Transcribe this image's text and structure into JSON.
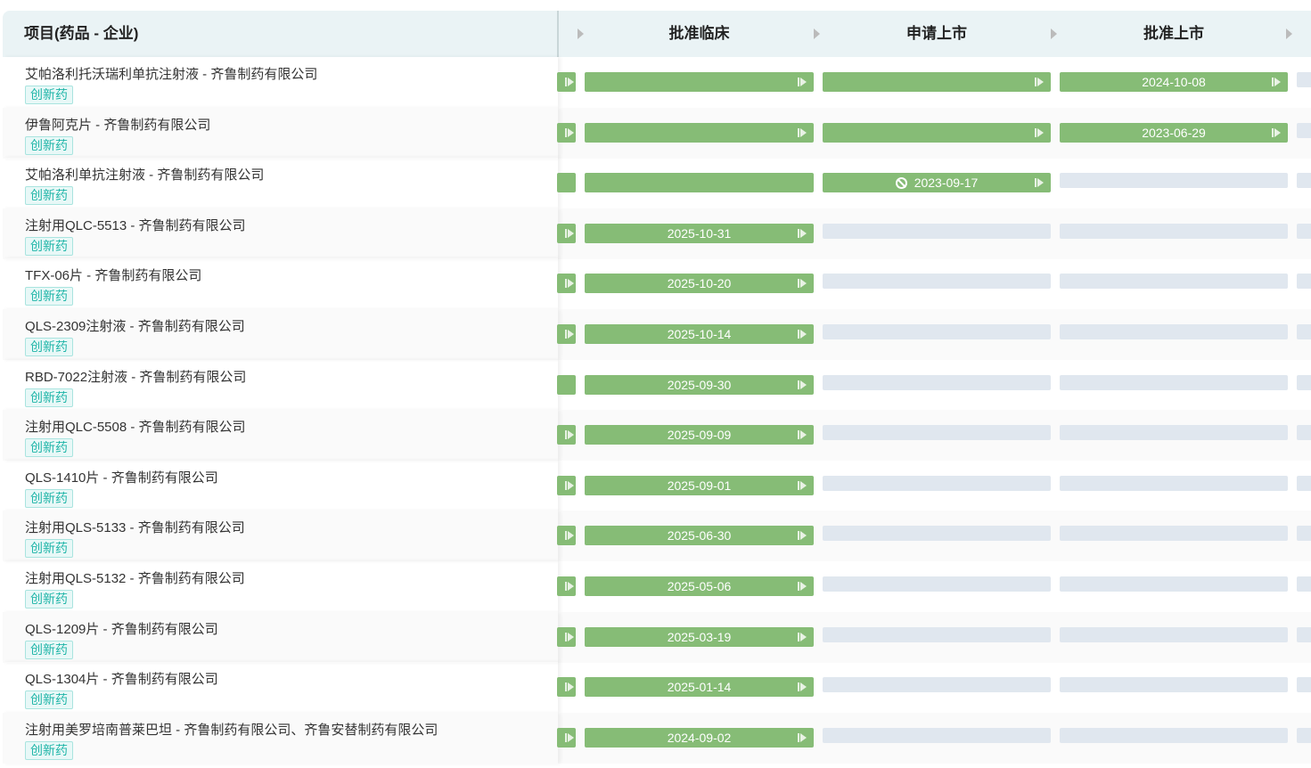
{
  "header": {
    "project_col": "项目(药品 - 企业)",
    "stages": [
      "批准临床",
      "申请上市",
      "批准上市"
    ]
  },
  "colors": {
    "done": "#86bc76",
    "empty": "#e0e7ef",
    "tag": "#1fb5a8"
  },
  "rows": [
    {
      "name": "艾帕洛利托沃瑞利单抗注射液 - 齐鲁制药有限公司",
      "tag": "创新药",
      "stages": [
        {
          "s": "done"
        },
        {
          "s": "done"
        },
        {
          "s": "done"
        },
        {
          "s": "done",
          "date": "2024-10-08"
        }
      ]
    },
    {
      "name": "伊鲁阿克片 - 齐鲁制药有限公司",
      "tag": "创新药",
      "stages": [
        {
          "s": "done"
        },
        {
          "s": "done"
        },
        {
          "s": "done"
        },
        {
          "s": "done",
          "date": "2023-06-29"
        }
      ]
    },
    {
      "name": "艾帕洛利单抗注射液 - 齐鲁制药有限公司",
      "tag": "创新药",
      "stages": [
        {
          "s": "done",
          "noarrow": true
        },
        {
          "s": "done",
          "noarrow": true
        },
        {
          "s": "done",
          "date": "2023-09-17",
          "banned": true
        },
        {
          "s": "empty"
        }
      ]
    },
    {
      "name": "注射用QLC-5513 - 齐鲁制药有限公司",
      "tag": "创新药",
      "stages": [
        {
          "s": "done"
        },
        {
          "s": "done",
          "date": "2025-10-31"
        },
        {
          "s": "empty"
        },
        {
          "s": "empty"
        }
      ]
    },
    {
      "name": "TFX-06片 - 齐鲁制药有限公司",
      "tag": "创新药",
      "stages": [
        {
          "s": "done"
        },
        {
          "s": "done",
          "date": "2025-10-20"
        },
        {
          "s": "empty"
        },
        {
          "s": "empty"
        }
      ]
    },
    {
      "name": "QLS-2309注射液 - 齐鲁制药有限公司",
      "tag": "创新药",
      "stages": [
        {
          "s": "done"
        },
        {
          "s": "done",
          "date": "2025-10-14"
        },
        {
          "s": "empty"
        },
        {
          "s": "empty"
        }
      ]
    },
    {
      "name": "RBD-7022注射液 - 齐鲁制药有限公司",
      "tag": "创新药",
      "stages": [
        {
          "s": "done",
          "noarrow": true
        },
        {
          "s": "done",
          "date": "2025-09-30"
        },
        {
          "s": "empty"
        },
        {
          "s": "empty"
        }
      ]
    },
    {
      "name": "注射用QLC-5508 - 齐鲁制药有限公司",
      "tag": "创新药",
      "stages": [
        {
          "s": "done"
        },
        {
          "s": "done",
          "date": "2025-09-09"
        },
        {
          "s": "empty"
        },
        {
          "s": "empty"
        }
      ]
    },
    {
      "name": "QLS-1410片 - 齐鲁制药有限公司",
      "tag": "创新药",
      "stages": [
        {
          "s": "done"
        },
        {
          "s": "done",
          "date": "2025-09-01"
        },
        {
          "s": "empty"
        },
        {
          "s": "empty"
        }
      ]
    },
    {
      "name": "注射用QLS-5133 - 齐鲁制药有限公司",
      "tag": "创新药",
      "stages": [
        {
          "s": "done"
        },
        {
          "s": "done",
          "date": "2025-06-30"
        },
        {
          "s": "empty"
        },
        {
          "s": "empty"
        }
      ]
    },
    {
      "name": "注射用QLS-5132 - 齐鲁制药有限公司",
      "tag": "创新药",
      "stages": [
        {
          "s": "done"
        },
        {
          "s": "done",
          "date": "2025-05-06"
        },
        {
          "s": "empty"
        },
        {
          "s": "empty"
        }
      ]
    },
    {
      "name": "QLS-1209片 - 齐鲁制药有限公司",
      "tag": "创新药",
      "stages": [
        {
          "s": "done"
        },
        {
          "s": "done",
          "date": "2025-03-19"
        },
        {
          "s": "empty"
        },
        {
          "s": "empty"
        }
      ]
    },
    {
      "name": "QLS-1304片 - 齐鲁制药有限公司",
      "tag": "创新药",
      "stages": [
        {
          "s": "done"
        },
        {
          "s": "done",
          "date": "2025-01-14"
        },
        {
          "s": "empty"
        },
        {
          "s": "empty"
        }
      ]
    },
    {
      "name": "注射用美罗培南普莱巴坦 - 齐鲁制药有限公司、齐鲁安替制药有限公司",
      "tag": "创新药",
      "stages": [
        {
          "s": "done"
        },
        {
          "s": "done",
          "date": "2024-09-02"
        },
        {
          "s": "empty"
        },
        {
          "s": "empty"
        }
      ]
    }
  ]
}
